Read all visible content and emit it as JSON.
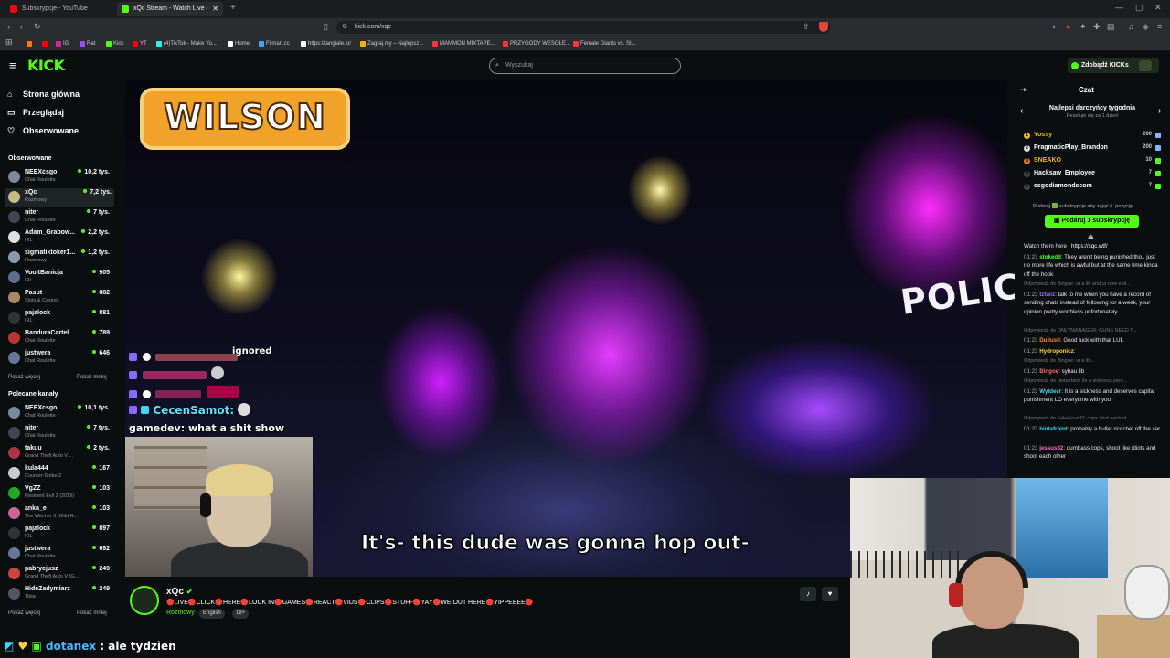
{
  "browser": {
    "tabs": [
      {
        "title": "Subskrypcje - YouTube",
        "color": "#ff0000"
      },
      {
        "title": "xQc Stream - Watch Live on Kick",
        "color": "#53fc18"
      }
    ],
    "url": "kick.com/xqc",
    "bookmarks": [
      {
        "label": "IG",
        "color": "#d6249f"
      },
      {
        "label": "Rat",
        "color": "#9c4dff"
      },
      {
        "label": "Kick",
        "color": "#53fc18"
      },
      {
        "label": "YT",
        "color": "#ff0000"
      },
      {
        "label": "(4)TikTok - Make Yo...",
        "color": "#25f4ee"
      },
      {
        "label": "Home",
        "color": "#ffffff"
      },
      {
        "label": "Filman.cc",
        "color": "#4aa3ff"
      },
      {
        "label": "https://tangiale.io/",
        "color": "#ffffff"
      },
      {
        "label": "Zagraj.my – Najlepsz...",
        "color": "#ffb000"
      },
      {
        "label": "MAMMON MIXTAPE...",
        "color": "#ff3333"
      },
      {
        "label": "PRZYGODY WESOŁE...",
        "color": "#ff3333"
      },
      {
        "label": "Female Giants vs. St...",
        "color": "#ff3333"
      }
    ]
  },
  "header": {
    "logo": "KICK",
    "search_placeholder": "Wyszukaj",
    "get_kicks": "Zdobądź KICKs"
  },
  "sidebar": {
    "nav": [
      {
        "icon": "⌂",
        "label": "Strona główna"
      },
      {
        "icon": "▭",
        "label": "Przeglądaj"
      },
      {
        "icon": "♡",
        "label": "Obserwowane"
      }
    ],
    "followed_title": "Obserwowane",
    "followed": [
      {
        "name": "NEEXcsgo",
        "cat": "Chat Roulette",
        "viewers": "10,2 tys.",
        "color": "#7a8a9a"
      },
      {
        "name": "xQc",
        "cat": "Rozmowy",
        "viewers": "7,2 tys.",
        "color": "#c9b98a"
      },
      {
        "name": "niter",
        "cat": "Chat Roulette",
        "viewers": "7 tys.",
        "color": "#445"
      },
      {
        "name": "Adam_Grabow...",
        "cat": "IRL",
        "viewers": "2,2 tys.",
        "color": "#e0e0e0"
      },
      {
        "name": "sigmatiktoker1...",
        "cat": "Rozmowy",
        "viewers": "1,2 tys.",
        "color": "#8899aa"
      },
      {
        "name": "VooltBanicja",
        "cat": "IRL",
        "viewers": "905",
        "color": "#5a6e8e"
      },
      {
        "name": "Pasut",
        "cat": "Slots & Casino",
        "viewers": "882",
        "color": "#a86"
      },
      {
        "name": "pajalock",
        "cat": "IRL",
        "viewers": "881",
        "color": "#333"
      },
      {
        "name": "BanduraCartel",
        "cat": "Chat Roulette",
        "viewers": "789",
        "color": "#b33"
      },
      {
        "name": "justwera",
        "cat": "Chat Roulette",
        "viewers": "646",
        "color": "#679"
      }
    ],
    "show_more": "Pokaż więcej",
    "show_less": "Pokaż mniej",
    "recommended_title": "Polecane kanały",
    "recommended": [
      {
        "name": "NEEXcsgo",
        "cat": "Chat Roulette",
        "viewers": "10,1 tys.",
        "color": "#7a8a9a"
      },
      {
        "name": "niter",
        "cat": "Chat Roulette",
        "viewers": "7 tys.",
        "color": "#445"
      },
      {
        "name": "takuu",
        "cat": "Grand Theft Auto V ...",
        "viewers": "2 tys.",
        "color": "#a34"
      },
      {
        "name": "kula444",
        "cat": "Counter-Strike 2",
        "viewers": "167",
        "color": "#ccc"
      },
      {
        "name": "VgZZ",
        "cat": "Resident Evil 2 (2019)",
        "viewers": "103",
        "color": "#2a2"
      },
      {
        "name": "anka_e",
        "cat": "The Witcher 3: Wild H...",
        "viewers": "103",
        "color": "#c69"
      },
      {
        "name": "pajalock",
        "cat": "IRL",
        "viewers": "897",
        "color": "#333"
      },
      {
        "name": "justwera",
        "cat": "Chat Roulette",
        "viewers": "692",
        "color": "#679"
      },
      {
        "name": "pabrycjusz",
        "cat": "Grand Theft Auto V (G...",
        "viewers": "249",
        "color": "#c44"
      },
      {
        "name": "HideZadymiarz",
        "cat": "Tibia",
        "viewers": "249",
        "color": "#556"
      }
    ]
  },
  "video": {
    "wilson": "WILSON",
    "police_text": "POLIC",
    "subtitle": "It's- this dude was gonna hop out-",
    "overlay_ignored": "ignored",
    "overlay_user": "CecenSamot:",
    "overlay_msg": "gamedev: what a shit show"
  },
  "stream": {
    "name": "xQc",
    "title": "🔴LIVE🔴CLICK🔴HERE🔴LOCK IN🔴GAMES🔴REACT🔴VIDS🔴CLIPS🔴STUFF🔴YAY🔴WE OUT HERE🔴YIPPEEEE🔴",
    "category": "Rozmowy",
    "tags": [
      "English",
      "18+"
    ]
  },
  "bottom_chat": {
    "user": "dotanex",
    "text": ": ale tydzien"
  },
  "chat": {
    "title": "Czat",
    "gift_title": "Najlepsi darczyńcy tygodnia",
    "gift_sub": "Resetuje się za 1 dzień",
    "gifters": [
      {
        "rank": "1",
        "name": "Yossy",
        "value": "200",
        "color": "#f5b800",
        "namecolor": "#f5b800"
      },
      {
        "rank": "2",
        "name": "PragmaticPlay_Brandon",
        "value": "200",
        "color": "#ddd",
        "namecolor": "#ffffff"
      },
      {
        "rank": "3",
        "name": "SNEAKO",
        "value": "10",
        "color": "#d07a2a",
        "namecolor": "#f5b800"
      },
      {
        "rank": "4",
        "name": "Hacksaw_Employee",
        "value": "7",
        "color": "#444",
        "namecolor": "#ffffff"
      },
      {
        "rank": "5",
        "name": "csgodiamondscom",
        "value": "7",
        "color": "#444",
        "namecolor": "#ffffff"
      }
    ],
    "gift_note": "Podaruj 🟩 subskrypcje aby zająć 6. pozycję",
    "gift_button": "Podaruj 1 subskrypcję",
    "messages": [
      {
        "time": "",
        "user": "",
        "text": "Watch them here ! ",
        "link": "https://xqc.wtf/",
        "ucolor": "#fff",
        "reply": false
      },
      {
        "time": "01:23",
        "user": "stokedd",
        "text": ": They aren't being punished tho.. just no more life which is awful but at the same time kinda off the hook",
        "ucolor": "#53fc18",
        "reply": false
      },
      {
        "time": "",
        "user": "",
        "text": "Odpowiedź do Bingoe: ur a lib and ur now exit...",
        "ucolor": "#777",
        "reply": true
      },
      {
        "time": "01:23",
        "user": "tztwiz",
        "text": ": talk to me when you have a record of sending chats instead of following for a week, your opinion pretty worthless unfortunately",
        "ucolor": "#9c6bff",
        "reply": false
      },
      {
        "time": "",
        "user": "",
        "text": "Odpowiedź do ONLYMANAGER: GUNS NEED T...",
        "ucolor": "#777",
        "reply": true
      },
      {
        "time": "01:23",
        "user": "Dullusti",
        "text": ": Good luck with that LUL",
        "ucolor": "#ff8a3d",
        "reply": false
      },
      {
        "time": "01:23",
        "user": "Hydroponicz",
        "text": ": ",
        "ucolor": "#ffd23f",
        "reply": false
      },
      {
        "time": "",
        "user": "",
        "text": "Odpowiedź do Bingoe: ur a lib...",
        "ucolor": "#777",
        "reply": true
      },
      {
        "time": "01:23",
        "user": "Bingoe",
        "text": ": sybau lib",
        "ucolor": "#ff6b6b",
        "reply": false
      },
      {
        "time": "",
        "user": "",
        "text": "Odpowiedź do bintafrbint: its a sickness pers...",
        "ucolor": "#777",
        "reply": true
      },
      {
        "time": "01:23",
        "user": "Wyldecr",
        "text": ": It is a sickness and deserves capital punishment LO everytime with you",
        "ucolor": "#3dd6ff",
        "reply": false
      },
      {
        "time": "",
        "user": "",
        "text": "Odpowiedź do FakeFour33: cops shot each ot...",
        "ucolor": "#777",
        "reply": true
      },
      {
        "time": "01:23",
        "user": "bintafrbint",
        "text": ": probably a bullet ricochet off the car",
        "ucolor": "#3dd6ff",
        "reply": false
      },
      {
        "time": "01:23",
        "user": "jessus32",
        "text": ": dumbass cops, shoot like idiots and shoot each other",
        "ucolor": "#ff6bd6",
        "reply": false
      }
    ]
  }
}
